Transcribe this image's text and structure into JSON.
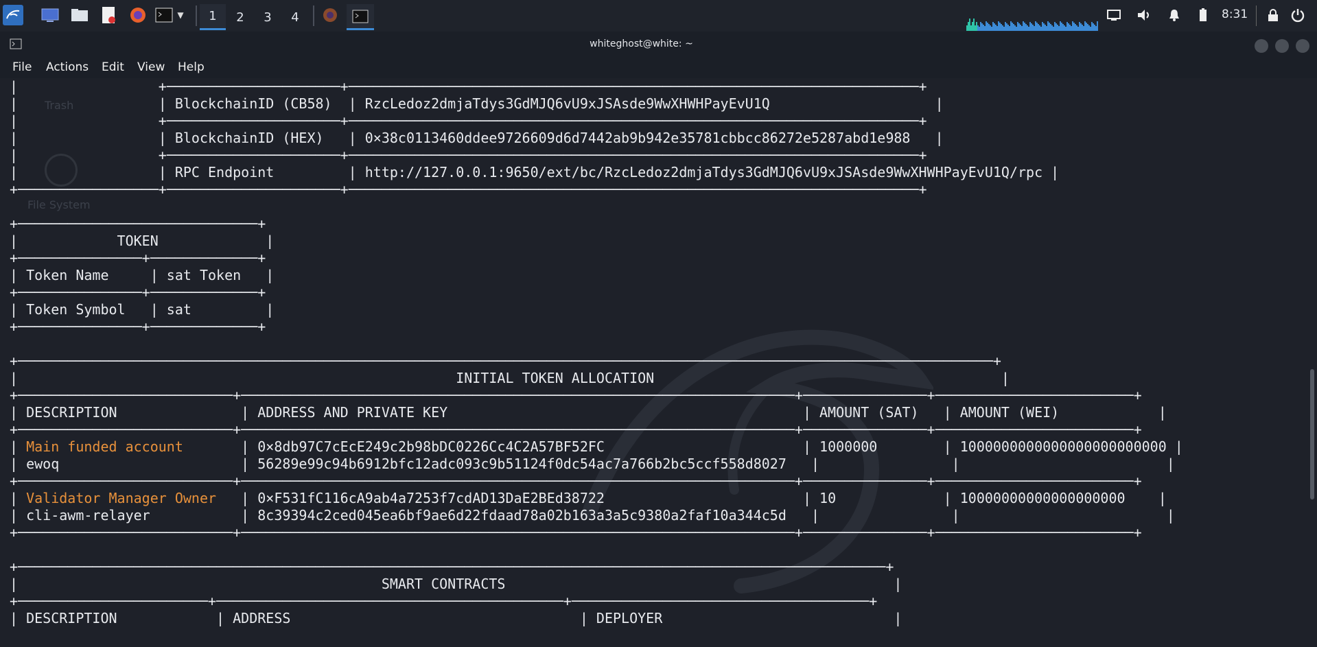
{
  "panel": {
    "workspaces": [
      "1",
      "2",
      "3",
      "4"
    ],
    "active_workspace": "1",
    "clock": "8:31",
    "accent_color": "#3d8bd6",
    "launcher_icons": [
      "kali-menu-icon",
      "desktop-icon",
      "file-manager-icon",
      "text-editor-icon",
      "firefox-icon",
      "terminal-icon",
      "chevron-down-icon"
    ],
    "tray_icons": [
      "network-icon",
      "volume-icon",
      "notification-bell-icon",
      "battery-icon",
      "lock-icon",
      "power-icon"
    ]
  },
  "window": {
    "title": "whiteghost@white: ~",
    "menu": [
      "File",
      "Actions",
      "Edit",
      "View",
      "Help"
    ]
  },
  "desktop": {
    "trash_label": "Trash",
    "filesystem_label": "File System"
  },
  "terminal": {
    "highlight_color": "#e8913b",
    "lines": [
      {
        "t": "|                 +─────────────────────+─────────────────────────────────────────────────────────────────────+"
      },
      {
        "t": "|                 | BlockchainID (CB58)  | RzcLedoz2dmjaTdys3GdMJQ6vU9xJSAsde9WwXHWHPayEvU1Q                    |"
      },
      {
        "t": "|                 +─────────────────────+─────────────────────────────────────────────────────────────────────+"
      },
      {
        "t": "|                 | BlockchainID (HEX)   | 0×38c0113460ddee9726609d6d7442ab9b942e35781cbbcc86272e5287abd1e988   |"
      },
      {
        "t": "|                 +─────────────────────+─────────────────────────────────────────────────────────────────────+"
      },
      {
        "t": "|                 | RPC Endpoint         | http://127.0.0.1:9650/ext/bc/RzcLedoz2dmjaTdys3GdMJQ6vU9xJSAsde9WwXHWHPayEvU1Q/rpc |"
      },
      {
        "t": "+─────────────────+─────────────────────+─────────────────────────────────────────────────────────────────────+"
      },
      {
        "t": ""
      },
      {
        "t": "+─────────────────────────────+"
      },
      {
        "t": "|            TOKEN             |"
      },
      {
        "t": "+───────────────+─────────────+"
      },
      {
        "t": "| Token Name     | sat Token   |"
      },
      {
        "t": "+───────────────+─────────────+"
      },
      {
        "t": "| Token Symbol   | sat         |"
      },
      {
        "t": "+───────────────+─────────────+"
      },
      {
        "t": ""
      },
      {
        "t": "+──────────────────────────────────────────────────────────────────────────────────────────────────────────────────────+"
      },
      {
        "t": "|                                                     INITIAL TOKEN ALLOCATION                                          |"
      },
      {
        "t": "+──────────────────────────+───────────────────────────────────────────────────────────────────+───────────────+────────────────────────+"
      },
      {
        "t": "| DESCRIPTION               | ADDRESS AND PRIVATE KEY                                           | AMOUNT (SAT)   | AMOUNT (WEI)            |"
      },
      {
        "t": "+──────────────────────────+───────────────────────────────────────────────────────────────────+───────────────+────────────────────────+"
      },
      {
        "t": "| ",
        "o": "Main funded account",
        "r": "       | 0×8db97C7cEcE249c2b98bDC0226Cc4C2A57BF52FC                        | 1000000        | 1000000000000000000000000 |"
      },
      {
        "t": "| ewoq                      | 56289e99c94b6912bfc12adc093c9b51124f0dc54ac7a766b2bc5ccf558d8027   |                |                         |"
      },
      {
        "t": "+──────────────────────────+───────────────────────────────────────────────────────────────────+───────────────+────────────────────────+"
      },
      {
        "t": "| ",
        "o": "Validator Manager Owner",
        "r": "   | 0×F531fC116cA9ab4a7253f7cdAD13DaE2BEd38722                        | 10             | 10000000000000000000    |"
      },
      {
        "t": "| cli-awm-relayer           | 8c39394c2ced045ea6bf9ae6d22fdaad78a02b163a3a5c9380a2faf10a344c5d   |                |                         |"
      },
      {
        "t": "+──────────────────────────+───────────────────────────────────────────────────────────────────+───────────────+────────────────────────+"
      },
      {
        "t": ""
      },
      {
        "t": "+─────────────────────────────────────────────────────────────────────────────────────────────────────────+"
      },
      {
        "t": "|                                            SMART CONTRACTS                                               |"
      },
      {
        "t": "+───────────────────────+──────────────────────────────────────────+────────────────────────────────────+"
      },
      {
        "t": "| DESCRIPTION            | ADDRESS                                   | DEPLOYER                            |"
      }
    ]
  }
}
